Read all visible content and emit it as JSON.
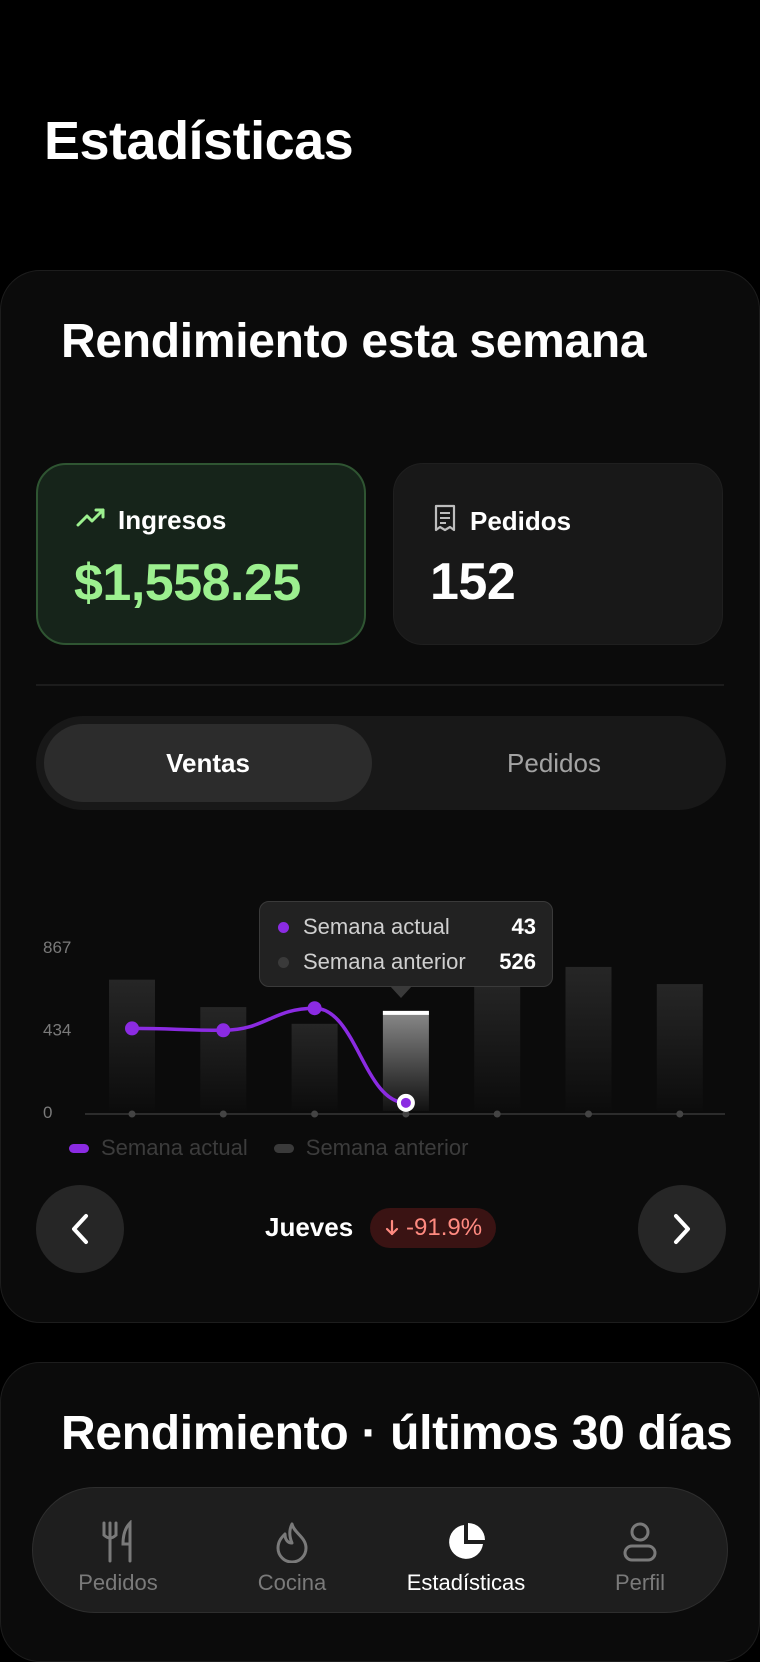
{
  "page": {
    "title": "Estadísticas"
  },
  "week_card": {
    "title": "Rendimiento esta semana",
    "metrics": {
      "income": {
        "label": "Ingresos",
        "value": "$1,558.25",
        "icon": "trending-up-icon"
      },
      "orders": {
        "label": "Pedidos",
        "value": "152",
        "icon": "receipt-icon"
      }
    },
    "segment": {
      "options": [
        "Ventas",
        "Pedidos"
      ],
      "selected": "Ventas"
    },
    "tooltip": {
      "rows": [
        {
          "label": "Semana actual",
          "value": "43"
        },
        {
          "label": "Semana anterior",
          "value": "526"
        }
      ]
    },
    "day_nav": {
      "day": "Jueves",
      "delta": "-91.9%"
    }
  },
  "chart_data": {
    "type": "bar",
    "y_ticks": [
      "0",
      "434",
      "867"
    ],
    "ylim": [
      0,
      867
    ],
    "grid": false,
    "legend_position": "bottom-left",
    "selected_index": 3,
    "series": [
      {
        "name": "Semana actual",
        "kind": "line",
        "color": "#8b2be2",
        "values": [
          434,
          424,
          540,
          43
        ]
      },
      {
        "name": "Semana anterior",
        "kind": "bar",
        "color": "#2a2a2a",
        "values": [
          690,
          546,
          458,
          526,
          707,
          757,
          667
        ]
      }
    ]
  },
  "legend": {
    "current": "Semana actual",
    "previous": "Semana anterior"
  },
  "month_card": {
    "title": "Rendimiento · últimos 30 días"
  },
  "tabbar": {
    "items": [
      {
        "label": "Pedidos",
        "icon": "fork-knife-icon"
      },
      {
        "label": "Cocina",
        "icon": "flame-icon"
      },
      {
        "label": "Estadísticas",
        "icon": "pie-chart-icon"
      },
      {
        "label": "Perfil",
        "icon": "user-icon"
      }
    ],
    "active": "Estadísticas"
  },
  "colors": {
    "accent": "#8b2be2",
    "income_green": "#9cf08f",
    "negative": "#ff8a80"
  }
}
